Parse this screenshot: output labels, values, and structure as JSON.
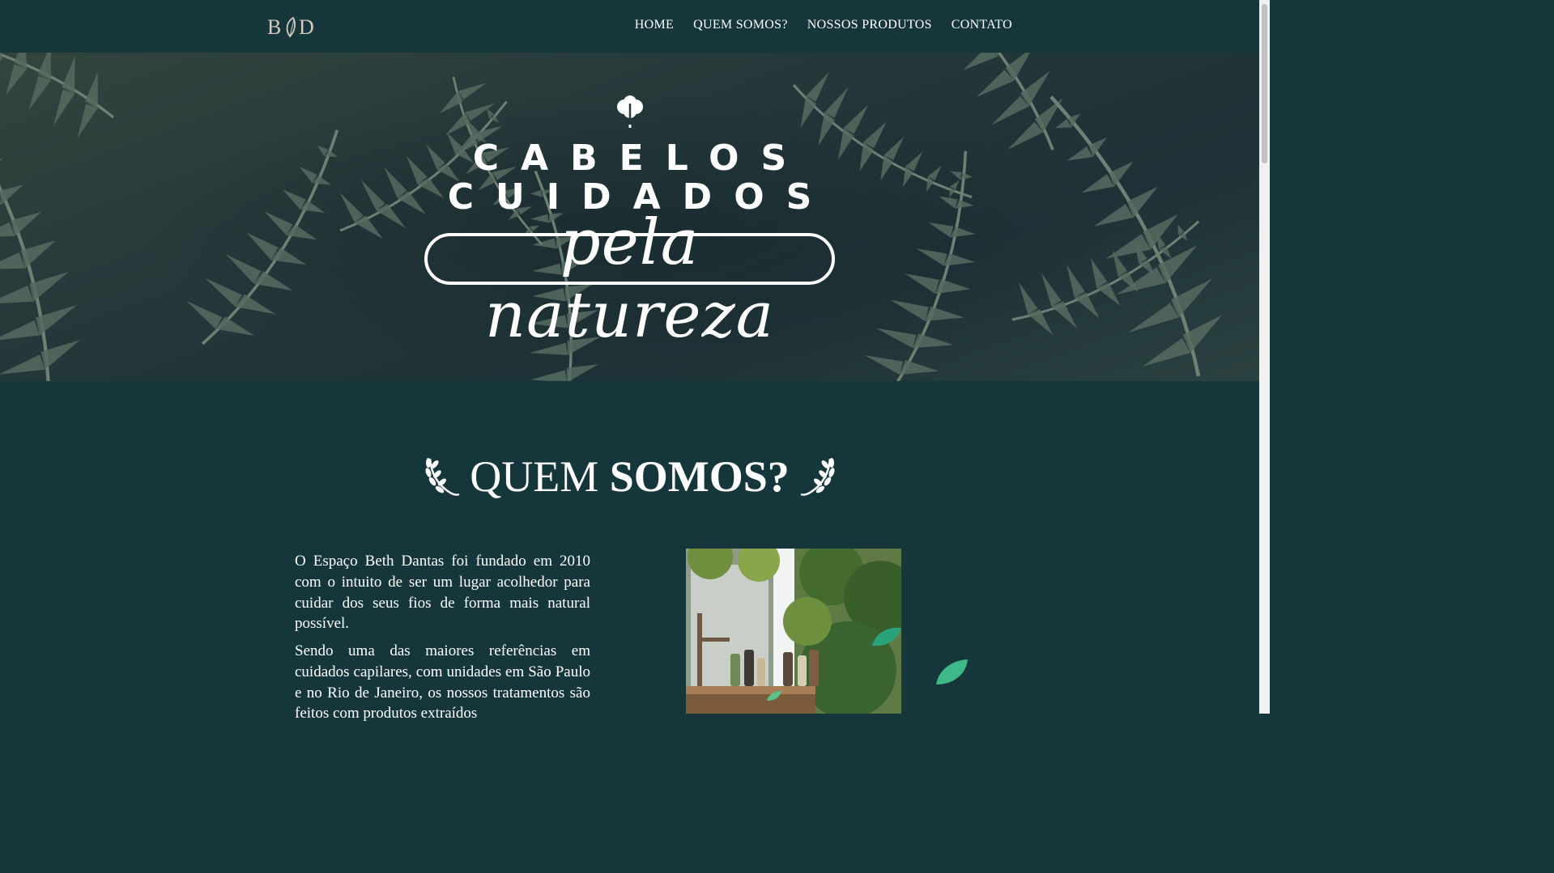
{
  "brand": {
    "logo_text": "B❀D"
  },
  "nav": {
    "items": [
      "HOME",
      "QUEM SOMOS?",
      "NOSSOS PRODUTOS",
      "CONTATO"
    ]
  },
  "hero": {
    "line1": "CABELOS",
    "line2": "CUIDADOS",
    "script": "pela natureza"
  },
  "about": {
    "title_light": "QUEM",
    "title_bold": "SOMOS?",
    "paragraphs": [
      "O Espaço Beth Dantas foi fundado em 2010 com o intuito de ser um lugar acolhedor para cuidar dos seus fios de forma mais natural possível.",
      "Sendo uma das maiores referências em cuidados capilares, com unidades em São Paulo e no Rio de Janeiro, os nossos tratamentos são feitos com produtos extraídos"
    ]
  },
  "colors": {
    "background": "#15373b",
    "text": "#ffffff",
    "leaf": "#2aa37a",
    "logo": "#d8c9c0"
  },
  "icons": [
    "leaf-logo-icon",
    "tree-icon",
    "laurel-left-icon",
    "laurel-right-icon",
    "leaf-icon"
  ]
}
